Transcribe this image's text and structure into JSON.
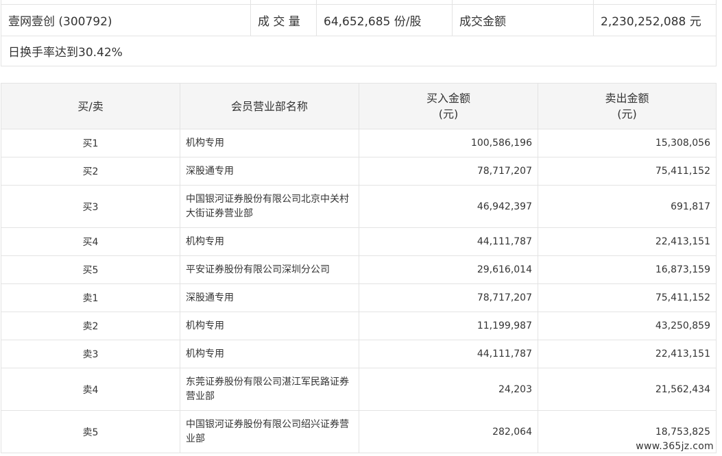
{
  "summary": {
    "stock": "壹网壹创 (300792)",
    "volume_label": "成 交 量",
    "volume_value": "64,652,685 份/股",
    "amount_label": "成交金额",
    "amount_value": "2,230,252,088 元",
    "note": "日换手率达到30.42%"
  },
  "detail": {
    "headers": {
      "side": "买/卖",
      "broker": "会员营业部名称",
      "buy_line1": "买入金额",
      "buy_line2": "(元)",
      "sell_line1": "卖出金额",
      "sell_line2": "(元)"
    },
    "rows": [
      {
        "side": "买1",
        "broker": "机构专用",
        "buy": "100,586,196",
        "sell": "15,308,056"
      },
      {
        "side": "买2",
        "broker": "深股通专用",
        "buy": "78,717,207",
        "sell": "75,411,152"
      },
      {
        "side": "买3",
        "broker": "中国银河证券股份有限公司北京中关村大街证券营业部",
        "buy": "46,942,397",
        "sell": "691,817"
      },
      {
        "side": "买4",
        "broker": "机构专用",
        "buy": "44,111,787",
        "sell": "22,413,151"
      },
      {
        "side": "买5",
        "broker": "平安证券股份有限公司深圳分公司",
        "buy": "29,616,014",
        "sell": "16,873,159"
      },
      {
        "side": "卖1",
        "broker": "深股通专用",
        "buy": "78,717,207",
        "sell": "75,411,152"
      },
      {
        "side": "卖2",
        "broker": "机构专用",
        "buy": "11,199,987",
        "sell": "43,250,859"
      },
      {
        "side": "卖3",
        "broker": "机构专用",
        "buy": "44,111,787",
        "sell": "22,413,151"
      },
      {
        "side": "卖4",
        "broker": "东莞证券股份有限公司湛江军民路证券营业部",
        "buy": "24,203",
        "sell": "21,562,434"
      },
      {
        "side": "卖5",
        "broker": "中国银河证券股份有限公司绍兴证券营业部",
        "buy": "282,064",
        "sell": "18,753,825"
      }
    ]
  },
  "watermark": "www.365jz.com"
}
